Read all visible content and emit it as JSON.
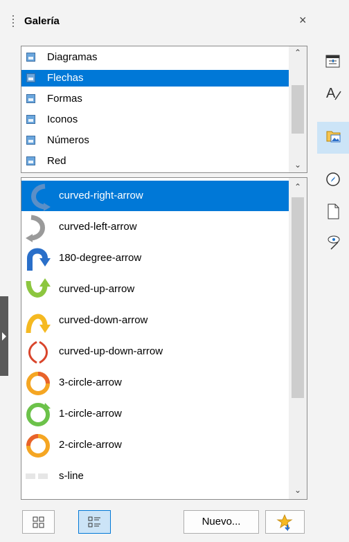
{
  "deck": {
    "title": "Galería",
    "close_glyph": "×"
  },
  "themes": [
    {
      "label": "Diagramas",
      "selected": false
    },
    {
      "label": "Flechas",
      "selected": true
    },
    {
      "label": "Formas",
      "selected": false
    },
    {
      "label": "Iconos",
      "selected": false
    },
    {
      "label": "Números",
      "selected": false
    },
    {
      "label": "Red",
      "selected": false
    }
  ],
  "items": [
    {
      "label": "curved-right-arrow",
      "selected": true,
      "icon": "curved-right-arrow-icon"
    },
    {
      "label": "curved-left-arrow",
      "selected": false,
      "icon": "curved-left-arrow-icon"
    },
    {
      "label": "180-degree-arrow",
      "selected": false,
      "icon": "180-degree-arrow-icon"
    },
    {
      "label": "curved-up-arrow",
      "selected": false,
      "icon": "curved-up-arrow-icon"
    },
    {
      "label": "curved-down-arrow",
      "selected": false,
      "icon": "curved-down-arrow-icon"
    },
    {
      "label": "curved-up-down-arrow",
      "selected": false,
      "icon": "curved-up-down-arrow-icon"
    },
    {
      "label": "3-circle-arrow",
      "selected": false,
      "icon": "3-circle-arrow-icon"
    },
    {
      "label": "1-circle-arrow",
      "selected": false,
      "icon": "1-circle-arrow-icon"
    },
    {
      "label": "2-circle-arrow",
      "selected": false,
      "icon": "2-circle-arrow-icon"
    },
    {
      "label": "s-line",
      "selected": false,
      "icon": "s-line-icon"
    }
  ],
  "buttons": {
    "new_label": "Nuevo..."
  },
  "tabbar": {
    "tabs": [
      "properties-icon",
      "styles-icon",
      "gallery-icon",
      "navigator-icon",
      "page-icon",
      "style-inspector-icon"
    ],
    "active": "gallery-icon"
  },
  "colors": {
    "selection": "#0078d7",
    "active_tab": "#cce4f7"
  }
}
